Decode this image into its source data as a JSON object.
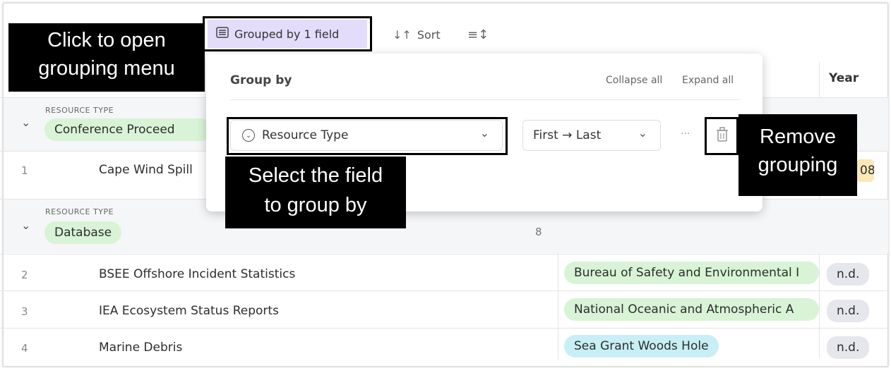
{
  "toolbar": {
    "grouped_label": "Grouped by 1 field",
    "sort_label": "Sort",
    "sort_icon": "sort-arrows-icon",
    "density_icon": "row-height-icon",
    "grouped_icon": "list-group-icon"
  },
  "columns": {
    "year": "Year"
  },
  "groups": [
    {
      "field_label": "RESOURCE TYPE",
      "value": "Conference Proceed"
    },
    {
      "field_label": "RESOURCE TYPE",
      "value": "Database",
      "count": "8"
    }
  ],
  "rows": [
    {
      "num": "1",
      "title": "Cape Wind Spill",
      "year": "08"
    },
    {
      "num": "2",
      "title": "BSEE Offshore Incident Statistics",
      "org": "Bureau of Safety and Environmental I",
      "year": "n.d."
    },
    {
      "num": "3",
      "title": "IEA Ecosystem Status Reports",
      "org": "National Oceanic and Atmospheric A",
      "year": "n.d."
    },
    {
      "num": "4",
      "title": "Marine Debris",
      "org": "Sea Grant Woods Hole",
      "year": "n.d."
    }
  ],
  "popup": {
    "title": "Group by",
    "collapse_all": "Collapse all",
    "expand_all": "Expand all",
    "field_select": "Resource Type",
    "order_select": "First → Last",
    "more": "···"
  },
  "callouts": {
    "open_menu_line1": "Click to open",
    "open_menu_line2": "grouping menu",
    "select_field_line1": "Select the field",
    "select_field_line2": "to group by",
    "remove_line1": "Remove",
    "remove_line2": "grouping"
  },
  "colors": {
    "grouped_bg": "#e3ddfb",
    "pill_green": "#d8f3d6",
    "pill_cyan": "#c8eef6",
    "pill_gray": "#e6e7ec",
    "year_yellow": "#fbe7b8"
  }
}
